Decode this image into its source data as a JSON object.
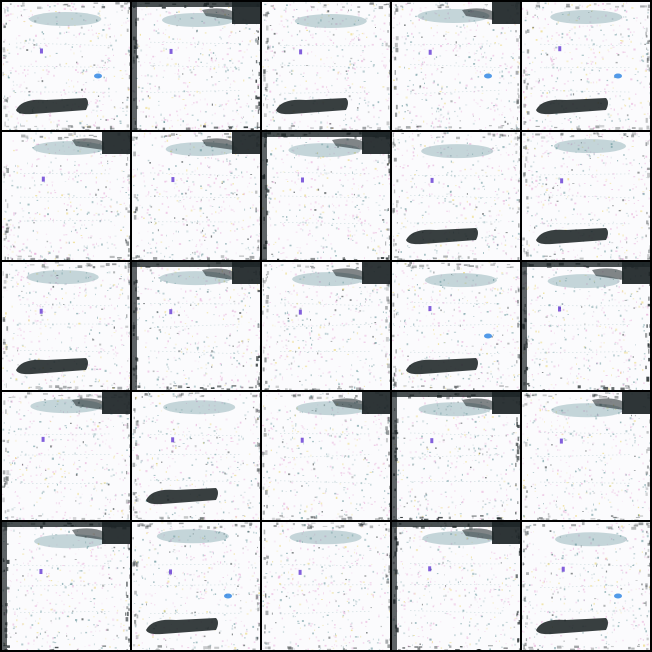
{
  "grid": {
    "rows": 5,
    "cols": 5,
    "tiles": [
      {
        "blotch": "bottom",
        "corner": "none",
        "heavy_frame": false,
        "blue_dot": true
      },
      {
        "blotch": "none",
        "corner": "top-right",
        "heavy_frame": true,
        "blue_dot": false
      },
      {
        "blotch": "bottom",
        "corner": "none",
        "heavy_frame": false,
        "blue_dot": false
      },
      {
        "blotch": "none",
        "corner": "top-right",
        "heavy_frame": false,
        "blue_dot": true
      },
      {
        "blotch": "bottom",
        "corner": "none",
        "heavy_frame": false,
        "blue_dot": true
      },
      {
        "blotch": "none",
        "corner": "top-right",
        "heavy_frame": false,
        "blue_dot": false
      },
      {
        "blotch": "none",
        "corner": "top-right",
        "heavy_frame": false,
        "blue_dot": false
      },
      {
        "blotch": "none",
        "corner": "top-right",
        "heavy_frame": true,
        "blue_dot": false
      },
      {
        "blotch": "bottom",
        "corner": "none",
        "heavy_frame": false,
        "blue_dot": false
      },
      {
        "blotch": "bottom",
        "corner": "none",
        "heavy_frame": false,
        "blue_dot": false
      },
      {
        "blotch": "bottom",
        "corner": "none",
        "heavy_frame": false,
        "blue_dot": false
      },
      {
        "blotch": "none",
        "corner": "top-right",
        "heavy_frame": true,
        "blue_dot": false
      },
      {
        "blotch": "none",
        "corner": "top-right",
        "heavy_frame": false,
        "blue_dot": false
      },
      {
        "blotch": "bottom",
        "corner": "none",
        "heavy_frame": false,
        "blue_dot": true
      },
      {
        "blotch": "none",
        "corner": "top-right",
        "heavy_frame": true,
        "blue_dot": false
      },
      {
        "blotch": "none",
        "corner": "top-right",
        "heavy_frame": false,
        "blue_dot": false
      },
      {
        "blotch": "bottom",
        "corner": "none",
        "heavy_frame": false,
        "blue_dot": false
      },
      {
        "blotch": "none",
        "corner": "top-right",
        "heavy_frame": false,
        "blue_dot": false
      },
      {
        "blotch": "none",
        "corner": "top-right",
        "heavy_frame": true,
        "blue_dot": false
      },
      {
        "blotch": "none",
        "corner": "top-right",
        "heavy_frame": false,
        "blue_dot": false
      },
      {
        "blotch": "none",
        "corner": "top-right",
        "heavy_frame": true,
        "blue_dot": false
      },
      {
        "blotch": "bottom",
        "corner": "none",
        "heavy_frame": false,
        "blue_dot": true
      },
      {
        "blotch": "none",
        "corner": "none",
        "heavy_frame": false,
        "blue_dot": false
      },
      {
        "blotch": "none",
        "corner": "top-right",
        "heavy_frame": true,
        "blue_dot": false
      },
      {
        "blotch": "bottom",
        "corner": "none",
        "heavy_frame": false,
        "blue_dot": true
      }
    ]
  },
  "colors": {
    "background": "#000000",
    "tile": "#fbfbfd",
    "ink": "#1c2426",
    "teal": "#5f8f95",
    "pink": "#e6a9d6",
    "blue": "#3f8fe6",
    "purple": "#5a2bd0",
    "yellow": "#e9d36a"
  }
}
